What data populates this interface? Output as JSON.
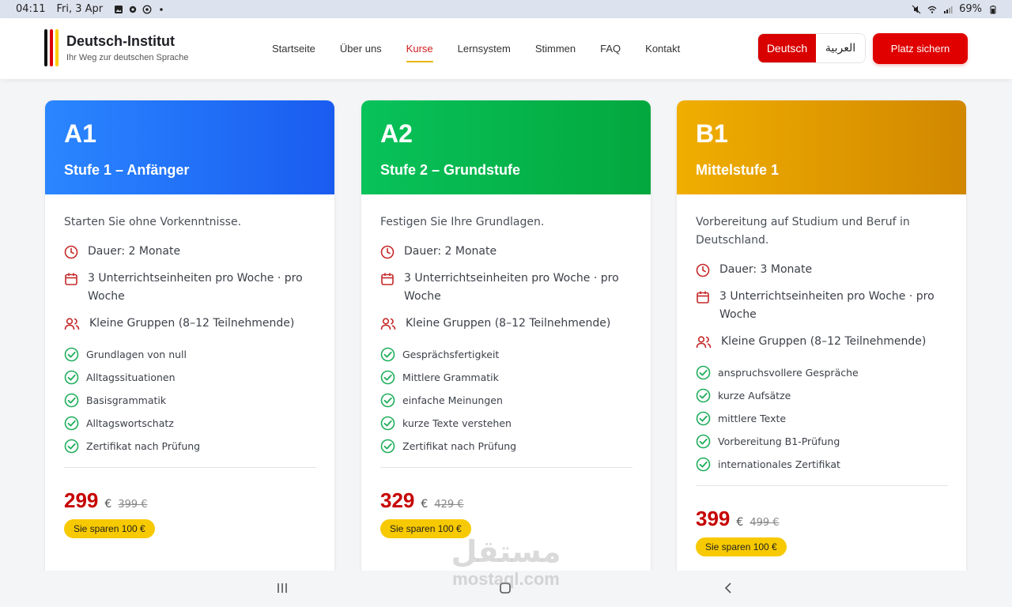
{
  "status_bar": {
    "time": "04:11",
    "date": "Fri, 3 Apr",
    "battery": "69%",
    "icons": [
      "gallery-icon",
      "gear-icon",
      "whatsapp-icon",
      "dot-icon",
      "mute-icon",
      "wifi-icon",
      "signal-icon",
      "battery-icon"
    ]
  },
  "brand": {
    "name": "Deutsch-Institut",
    "tagline": "Ihr Weg zur deutschen Sprache",
    "flag_colors": [
      "#111111",
      "#dd0000",
      "#ffce00"
    ]
  },
  "nav": {
    "items": [
      {
        "label": "Startseite",
        "active": false
      },
      {
        "label": "Über uns",
        "active": false
      },
      {
        "label": "Kurse",
        "active": true
      },
      {
        "label": "Lernsystem",
        "active": false
      },
      {
        "label": "Stimmen",
        "active": false
      },
      {
        "label": "FAQ",
        "active": false
      },
      {
        "label": "Kontakt",
        "active": false
      }
    ]
  },
  "language": {
    "german": "Deutsch",
    "arabic": "العربية",
    "selected": "Deutsch"
  },
  "cta_label": "Platz sichern",
  "cards": [
    {
      "level": "A1",
      "subtitle": "Stufe 1 – Anfänger",
      "description": "Starten Sie ohne Vorkenntnisse.",
      "duration": "Dauer: 2 Monate",
      "sessions": "3 Unterrichtseinheiten pro Woche · pro Woche",
      "groups": "Kleine Gruppen (8–12 Teilnehmende)",
      "features": [
        "Grundlagen von null",
        "Alltagssituationen",
        "Basisgrammatik",
        "Alltagswortschatz",
        "Zertifikat nach Prüfung"
      ],
      "price": "299",
      "currency": "€",
      "old_price": "399 €",
      "savings": "Sie sparen 100 €",
      "colors": [
        "#2a86ff",
        "#1a5cf0"
      ]
    },
    {
      "level": "A2",
      "subtitle": "Stufe 2 – Grundstufe",
      "description": "Festigen Sie Ihre Grundlagen.",
      "duration": "Dauer: 2 Monate",
      "sessions": "3 Unterrichtseinheiten pro Woche · pro Woche",
      "groups": "Kleine Gruppen (8–12 Teilnehmende)",
      "features": [
        "Gesprächsfertigkeit",
        "Mittlere Grammatik",
        "einfache Meinungen",
        "kurze Texte verstehen",
        "Zertifikat nach Prüfung"
      ],
      "price": "329",
      "currency": "€",
      "old_price": "429 €",
      "savings": "Sie sparen 100 €",
      "colors": [
        "#08c25a",
        "#03a83e"
      ]
    },
    {
      "level": "B1",
      "subtitle": "Mittelstufe 1",
      "description": "Vorbereitung auf Studium und Beruf in Deutschland.",
      "duration": "Dauer: 3 Monate",
      "sessions": "3 Unterrichtseinheiten pro Woche · pro Woche",
      "groups": "Kleine Gruppen (8–12 Teilnehmende)",
      "features": [
        "anspruchsvollere Gespräche",
        "kurze Aufsätze",
        "mittlere Texte",
        "Vorbereitung B1-Prüfung",
        "internationales Zertifikat"
      ],
      "price": "399",
      "currency": "€",
      "old_price": "499 €",
      "savings": "Sie sparen 100 €",
      "colors": [
        "#f0ae00",
        "#d18700"
      ]
    }
  ],
  "accent": {
    "red": "#d90000",
    "check_green": "#1fae5b",
    "icon_red": "#c62828",
    "yellow": "#f7c900"
  },
  "watermark": {
    "arabic": "مستقل",
    "latin": "mostaql.com"
  },
  "system_nav": {
    "icons": [
      "recent-apps-icon",
      "home-icon",
      "back-icon"
    ]
  }
}
